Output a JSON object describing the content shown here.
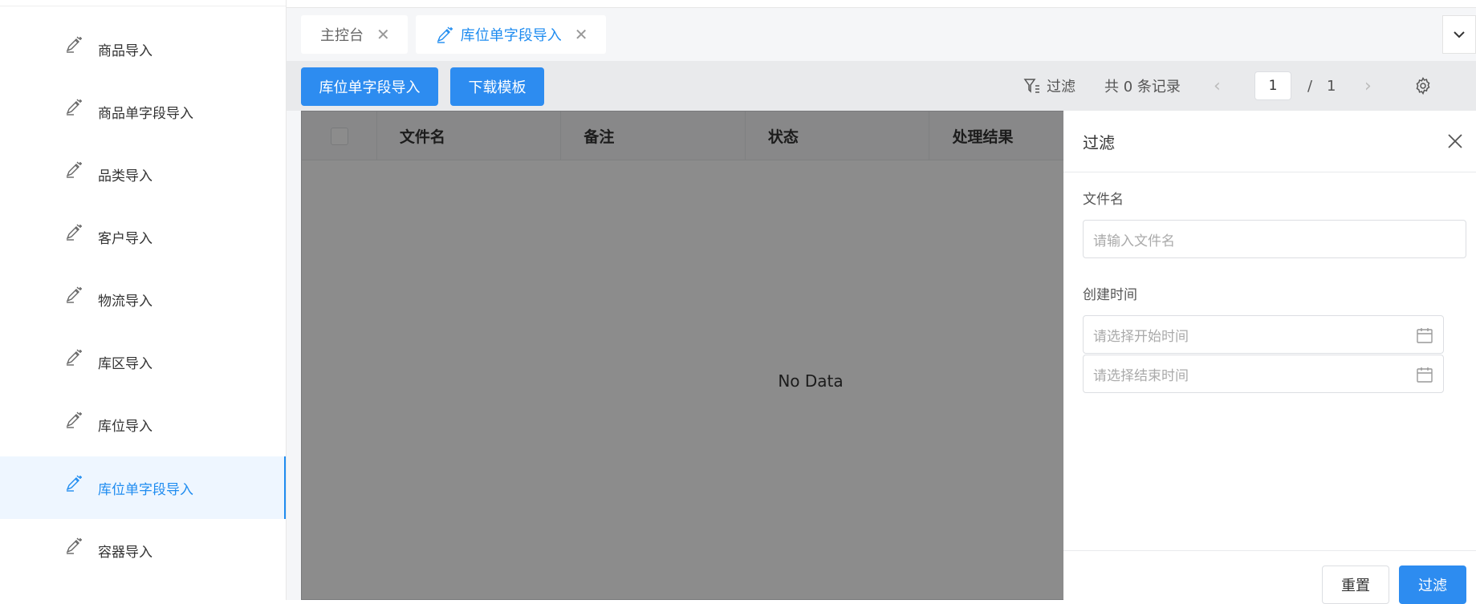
{
  "sidebar": {
    "items": [
      {
        "label": "商品导入",
        "icon": "import-edit-icon",
        "active": false
      },
      {
        "label": "商品单字段导入",
        "icon": "import-edit-icon",
        "active": false
      },
      {
        "label": "品类导入",
        "icon": "import-edit-icon",
        "active": false
      },
      {
        "label": "客户导入",
        "icon": "import-edit-icon",
        "active": false
      },
      {
        "label": "物流导入",
        "icon": "import-edit-icon",
        "active": false
      },
      {
        "label": "库区导入",
        "icon": "import-edit-icon",
        "active": false
      },
      {
        "label": "库位导入",
        "icon": "import-edit-icon",
        "active": false
      },
      {
        "label": "库位单字段导入",
        "icon": "import-edit-icon",
        "active": true
      },
      {
        "label": "容器导入",
        "icon": "import-edit-icon",
        "active": false
      }
    ]
  },
  "tabs": [
    {
      "label": "主控台",
      "active": false
    },
    {
      "label": "库位单字段导入",
      "active": true
    }
  ],
  "toolbar": {
    "import_button": "库位单字段导入",
    "template_button": "下载模板",
    "filter_label": "过滤",
    "record_count": "共 0 条记录",
    "prev": "‹",
    "current_page": "1",
    "separator": "/",
    "total_pages": "1",
    "next": "›"
  },
  "table": {
    "columns": [
      "文件名",
      "备注",
      "状态",
      "处理结果"
    ],
    "empty_text": "No Data"
  },
  "drawer": {
    "title": "过滤",
    "fields": {
      "filename_label": "文件名",
      "filename_placeholder": "请输入文件名",
      "created_label": "创建时间",
      "start_placeholder": "请选择开始时间",
      "end_placeholder": "请选择结束时间"
    },
    "reset_button": "重置",
    "filter_button": "过滤"
  },
  "colors": {
    "primary": "#2d8cf0",
    "active_text": "#1f8cf0",
    "active_bg": "#eef6ff"
  }
}
